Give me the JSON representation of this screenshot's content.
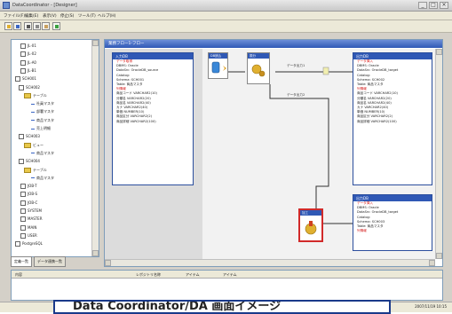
{
  "window": {
    "title": "DataCoordinator - [Designer]",
    "controls": [
      "_",
      "□",
      "×"
    ]
  },
  "menu": [
    "ファイル(F)",
    "編集(E)",
    "表示(V)",
    "停止(S)",
    "ツール(T)",
    "ヘルプ(H)"
  ],
  "toolbar": {
    "buttons": [
      "open-icon",
      "save-icon",
      "cut-icon",
      "copy-icon",
      "paste-icon",
      "run-icon"
    ]
  },
  "tree": {
    "items": [
      {
        "label": "JL-01",
        "kind": "node"
      },
      {
        "label": "JL-02",
        "kind": "node"
      },
      {
        "label": "JL-A0",
        "kind": "node"
      },
      {
        "label": "JL-B1",
        "kind": "node"
      },
      {
        "label": "SCH001",
        "kind": "node"
      },
      {
        "label": "SCH002",
        "kind": "node"
      },
      {
        "label": "テーブル",
        "kind": "folder"
      },
      {
        "label": "社員マスタ",
        "kind": "leaf"
      },
      {
        "label": "部署マスタ",
        "kind": "leaf"
      },
      {
        "label": "商品マスタ",
        "kind": "leaf"
      },
      {
        "label": "売上明細",
        "kind": "leaf"
      },
      {
        "label": "SCH003",
        "kind": "node"
      },
      {
        "label": "ビュー",
        "kind": "folder"
      },
      {
        "label": "商品マスタ",
        "kind": "leaf"
      },
      {
        "label": "SCH004",
        "kind": "node"
      },
      {
        "label": "テーブル",
        "kind": "folder"
      },
      {
        "label": "商品マスタ",
        "kind": "leaf"
      },
      {
        "label": "JOB-T",
        "kind": "node"
      },
      {
        "label": "JOB-S",
        "kind": "node"
      },
      {
        "label": "JOB-C",
        "kind": "node"
      },
      {
        "label": "SYSTEM",
        "kind": "node"
      },
      {
        "label": "MASTER",
        "kind": "node"
      },
      {
        "label": "MAIN",
        "kind": "node"
      },
      {
        "label": "USER",
        "kind": "node"
      },
      {
        "label": "PostgreSQL",
        "kind": "node"
      }
    ]
  },
  "bottom_tabs": [
    "定義一覧",
    "データ連携一覧"
  ],
  "document": {
    "header": "業務フロー1-フロー",
    "left_props": {
      "title": "入力DB",
      "lines": [
        {
          "text": "データ取得",
          "red": true
        },
        {
          "text": "DBMS: Oracle",
          "red": false
        },
        {
          "text": "DataSrc: OracleDB_source",
          "red": false
        },
        {
          "text": "Catalog:",
          "red": false
        },
        {
          "text": "Schema: SCH001",
          "red": false
        },
        {
          "text": "Table: 商品マスタ",
          "red": false
        },
        {
          "text": "列情報",
          "red": true
        },
        {
          "text": "商品コード VARCHAR2(10)",
          "red": false
        },
        {
          "text": "分類名 VARCHAR2(20)",
          "red": false
        },
        {
          "text": "商品名 VARCHAR2(40)",
          "red": false
        },
        {
          "text": "カナ VARCHAR2(40)",
          "red": false
        },
        {
          "text": "単価 NUMBER(10)",
          "red": false
        },
        {
          "text": "商品区分 VARCHAR2(2)",
          "red": false
        },
        {
          "text": "商品詳細 VARCHAR2(100)",
          "red": false
        }
      ]
    },
    "right_props_top": {
      "title": "出力DB",
      "lines": [
        {
          "text": "データ挿入",
          "red": true
        },
        {
          "text": "DBMS: Oracle",
          "red": false
        },
        {
          "text": "DataSrc: OracleDB_target",
          "red": false
        },
        {
          "text": "Catalog:",
          "red": false
        },
        {
          "text": "Schema: SCH002",
          "red": false
        },
        {
          "text": "Table: 商品マスタ",
          "red": false
        },
        {
          "text": "列情報",
          "red": true
        },
        {
          "text": "商品コード VARCHAR2(10)",
          "red": false
        },
        {
          "text": "分類名 VARCHAR2(20)",
          "red": false
        },
        {
          "text": "商品名 VARCHAR2(40)",
          "red": false
        },
        {
          "text": "カナ VARCHAR2(40)",
          "red": false
        },
        {
          "text": "単価 NUMBER(10)",
          "red": false
        },
        {
          "text": "商品区分 VARCHAR2(2)",
          "red": false
        },
        {
          "text": "商品詳細 VARCHAR2(100)",
          "red": false
        }
      ]
    },
    "right_props_bottom": {
      "title": "出力DB",
      "lines": [
        {
          "text": "データ挿入",
          "red": true
        },
        {
          "text": "DBMS: Oracle",
          "red": false
        },
        {
          "text": "DataSrc: OracleDB_target",
          "red": false
        },
        {
          "text": "Catalog:",
          "red": false
        },
        {
          "text": "Schema: SCH003",
          "red": false
        },
        {
          "text": "Table: 商品マスタ",
          "red": false
        },
        {
          "text": "列情報",
          "red": true
        }
      ]
    },
    "nodes": {
      "source": "DB読込",
      "split": "振分",
      "merge": "変換",
      "selected": "加工"
    },
    "flow_labels": [
      "データ出力1",
      "データ出力2"
    ]
  },
  "output": {
    "columns": [
      "内容",
      "レポジトリ名称",
      "アイテム",
      "アイテム"
    ]
  },
  "status": {
    "right": "2007/11/19 10:15"
  },
  "caption": "Data Coordinator/DA 画面イメージ",
  "colors": {
    "header_blue": "#2f58b5",
    "selected_red": "#d12a2a",
    "required_text": "#d41a1a"
  }
}
